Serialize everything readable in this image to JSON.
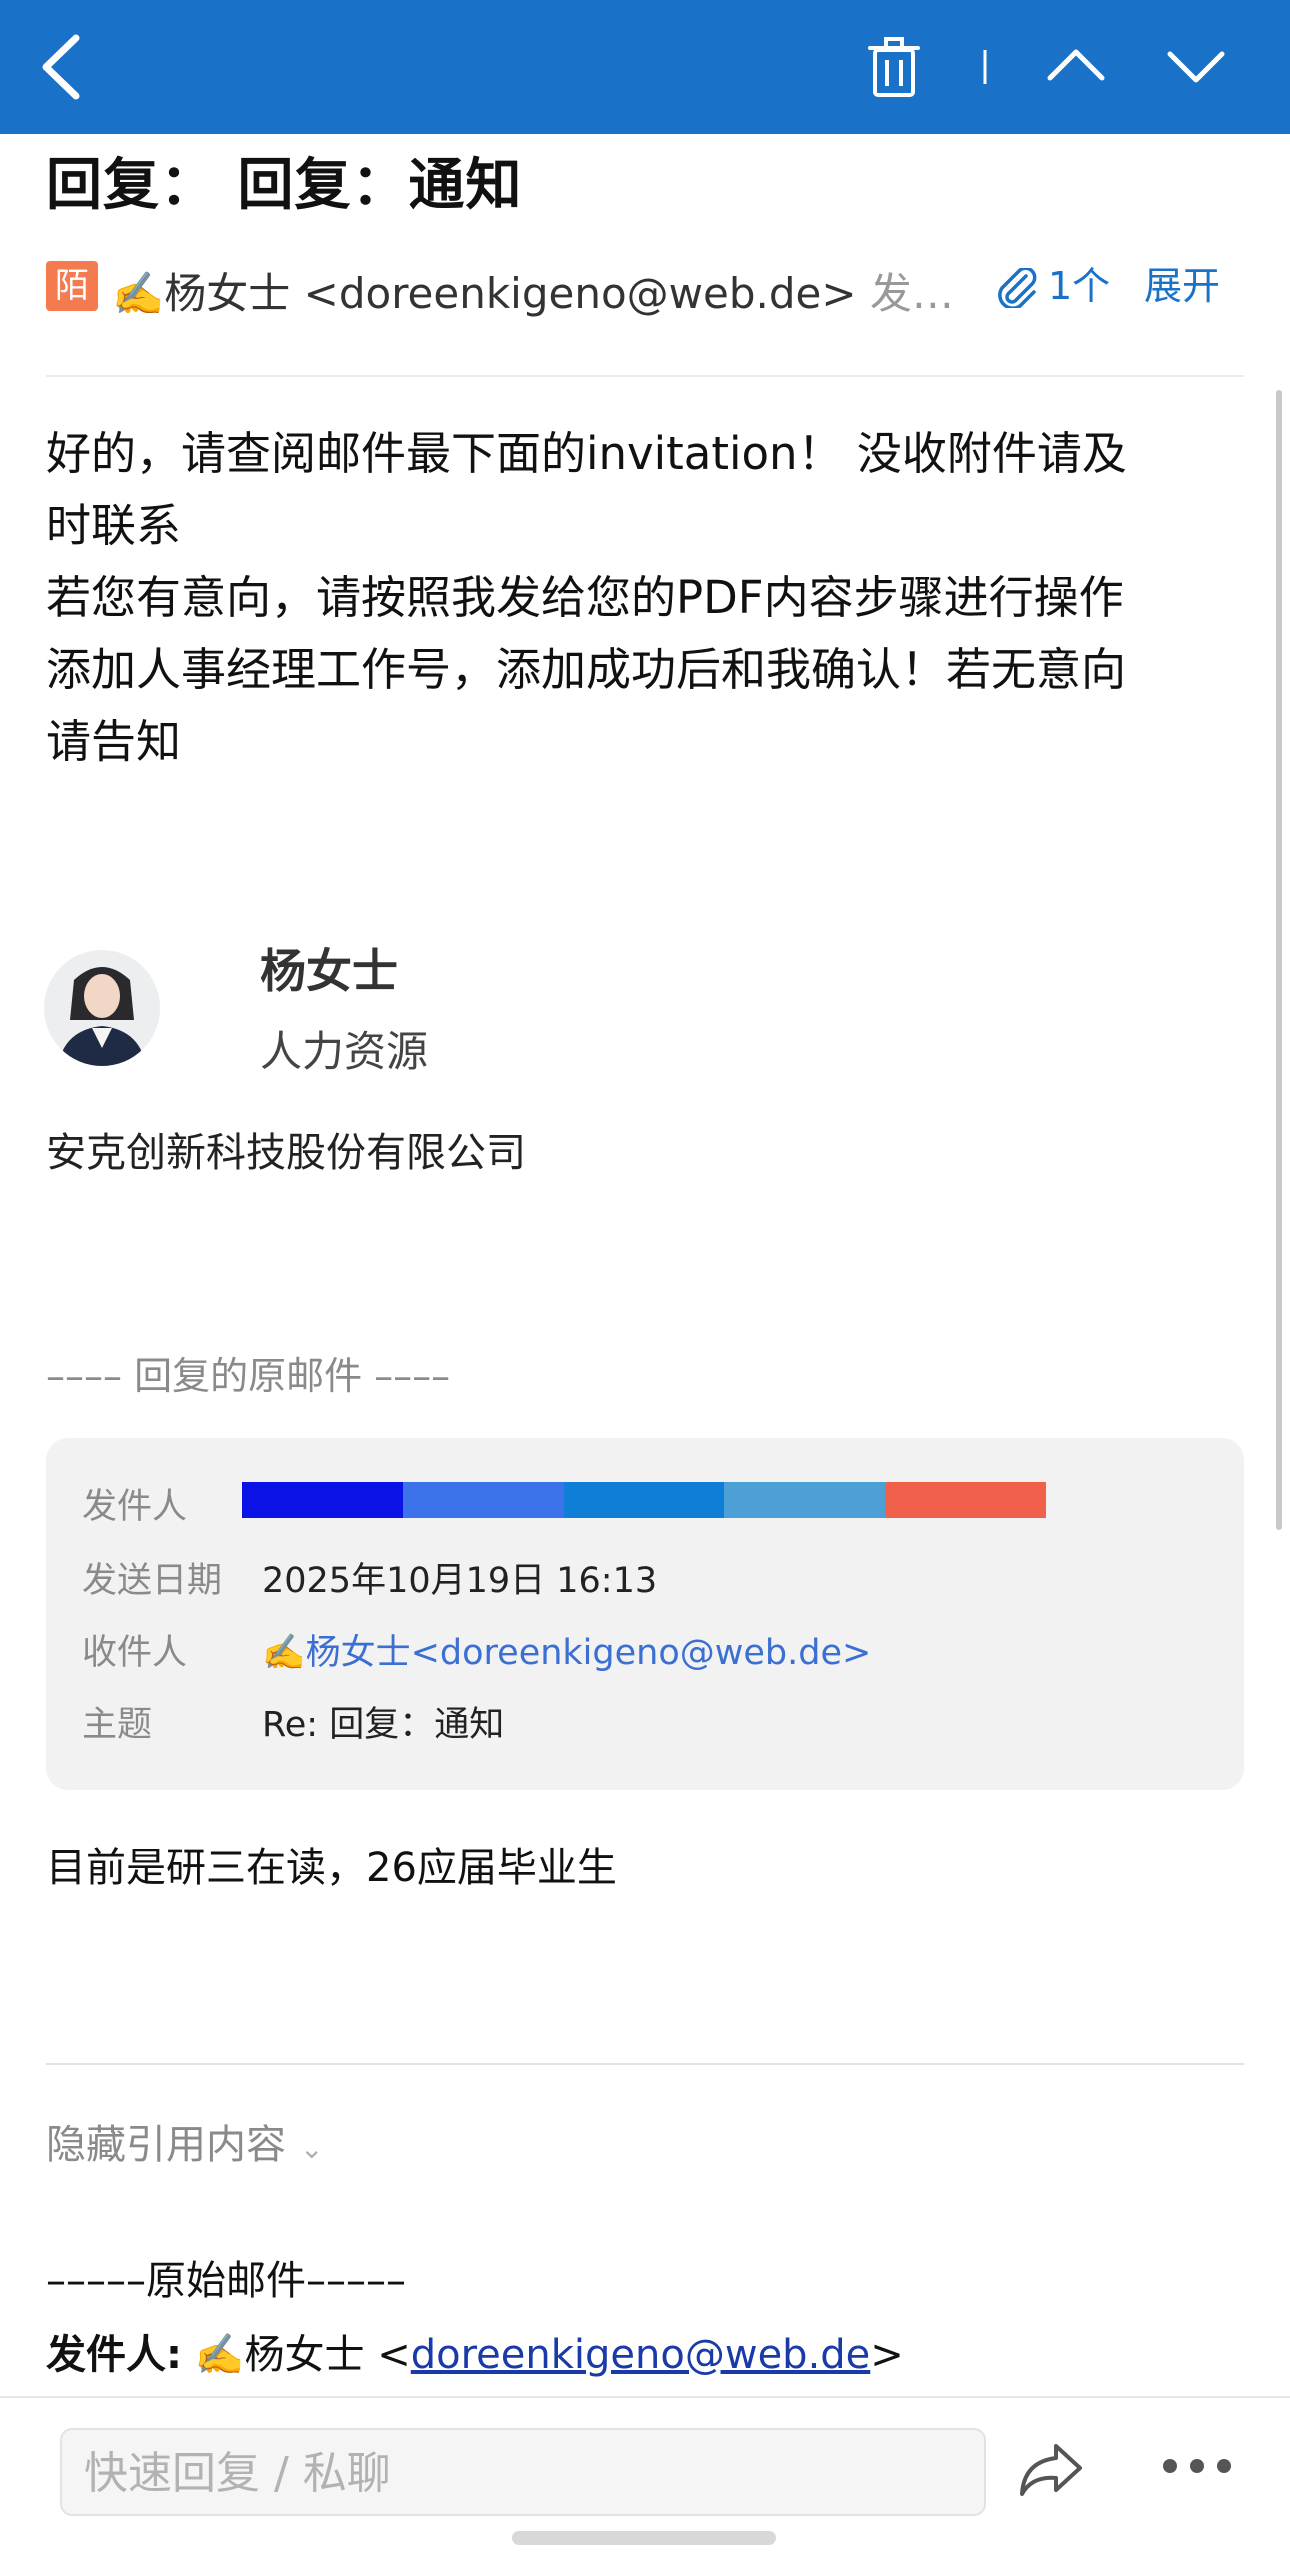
{
  "topbar": {
    "bg_color": "#1a72c8",
    "icons": [
      "back-icon",
      "trash-icon",
      "separator",
      "chevron-up-icon",
      "chevron-down-icon"
    ]
  },
  "subject": "回复： 回复：通知",
  "sender": {
    "tag": "陌",
    "display": "✍️杨女士 <doreenkigeno@web.de>",
    "suffix": "发…",
    "attachments": "1个",
    "expand_label": "展开"
  },
  "body": {
    "lines": [
      "好的，请查阅邮件最下面的invitation！ 没收附件请及",
      "时联系",
      "若您有意向，请按照我发给您的PDF内容步骤进行操作",
      "添加人事经理工作号，添加成功后和我确认！若无意向",
      "请告知"
    ]
  },
  "signature": {
    "name": "杨女士",
    "role": "人力资源",
    "company": "安克创新科技股份有限公司"
  },
  "reply_divider": "–––– 回复的原邮件 ––––",
  "quoted": {
    "from_label": "发件人",
    "redaction_colors": [
      "#0a12e6",
      "#3d73ea",
      "#0f7ed6",
      "#4da0d6",
      "#f0604a"
    ],
    "date_label": "发送日期",
    "date_value": "2025年10月19日 16:13",
    "to_label": "收件人",
    "to_value": "✍️杨女士<doreenkigeno@web.de>",
    "subject_label": "主题",
    "subject_value": "Re: 回复：通知"
  },
  "quoted_message": "目前是研三在读，26应届毕业生",
  "hide_quote_label": "隐藏引用内容",
  "original": {
    "header": "–––––原始邮件–––––",
    "from_label": "发件人:",
    "from_name": " ✍️杨女士 <",
    "from_email": "doreenkigeno@web.de",
    "from_close": ">"
  },
  "bottom": {
    "reply_placeholder": "快速回复 / 私聊"
  }
}
